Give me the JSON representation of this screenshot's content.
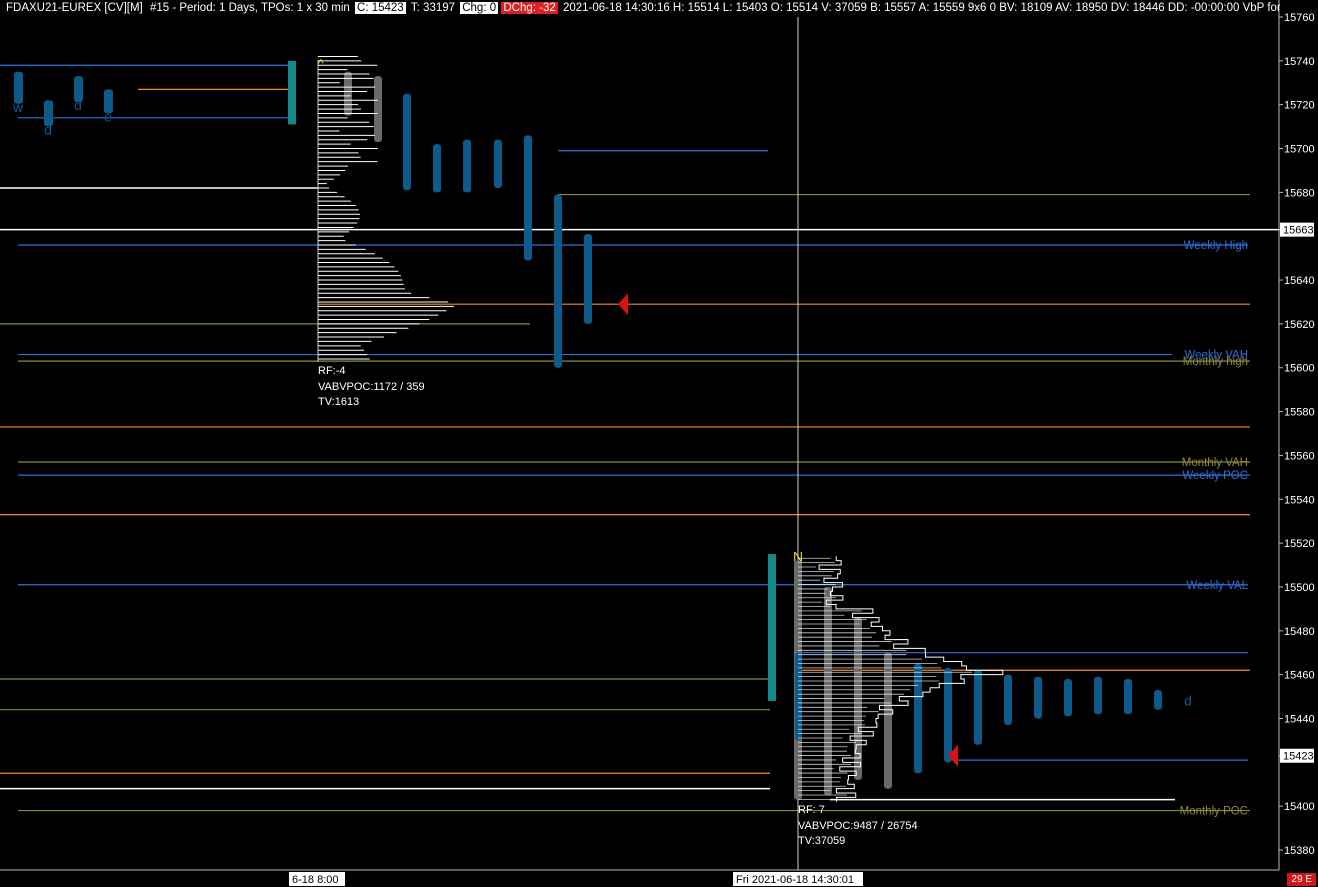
{
  "header": {
    "symbol": "FDAXU21-EUREX [CV][M]",
    "period": "#15 - Period: 1 Days, TPOs: 1 x 30 min",
    "close": "C: 15423",
    "trades": "T: 33197",
    "chg": "Chg: 0",
    "dchg": "DChg: -32",
    "rest": "2021-06-18 14:30:16 H: 15514 L: 15403 O: 15514 V: 37059 B: 15557 A: 15559 9x6 0 BV: 18109 AV: 18950 DV: 18446 DD: -00:00:00 VbP for TPO Chart"
  },
  "colors": {
    "background": "#000000",
    "blue": "#2f6fd6",
    "olive": "#8c8a3a",
    "orange": "#f08a30",
    "white": "#ffffff",
    "tpo_blue": "#0e5a8a",
    "tpo_gray": "#6a6a6a",
    "teal": "#138a8a",
    "red": "#e01010",
    "yellow": "#e8d820"
  },
  "chart_data": {
    "type": "tpo-profile",
    "y_axis": {
      "ylim": [
        15370,
        15770
      ],
      "ticks": [
        15760,
        15740,
        15720,
        15700,
        15680,
        15663,
        15640,
        15620,
        15600,
        15580,
        15560,
        15540,
        15520,
        15500,
        15480,
        15460,
        15440,
        15423,
        15400,
        15380
      ],
      "highlighted": [
        15663,
        15423
      ]
    },
    "x_axis": {
      "labels": [
        "6-18  8:00",
        "Fri 2021-06-18  14:30:01"
      ]
    },
    "level_labels": [
      {
        "text": "Weekly High",
        "price": 15656,
        "color": "blue"
      },
      {
        "text": "Monthly high",
        "price": 15603,
        "color": "olive"
      },
      {
        "text": "Weekly VAH",
        "price": 15606,
        "color": "blue"
      },
      {
        "text": "Monthly VAH",
        "price": 15557,
        "color": "olive"
      },
      {
        "text": "Weekly POC",
        "price": 15551,
        "color": "blue"
      },
      {
        "text": "Weekly VAL",
        "price": 15501,
        "color": "blue"
      },
      {
        "text": "Monthly POC",
        "price": 15398,
        "color": "olive"
      }
    ],
    "profiles": [
      {
        "session": "prior",
        "rf": "RF:-4",
        "vabvpoc": "VABVPOC:1172 / 359",
        "tv": "TV:1613",
        "high": 15742,
        "low": 15603,
        "poc": 15629,
        "vah": 15716,
        "val": 15605
      },
      {
        "session": "current",
        "rf": "RF: 7",
        "vabvpoc": "VABVPOC:9487 / 26754",
        "tv": "TV:37059",
        "high": 15514,
        "low": 15403,
        "poc": 15462,
        "vah": 15515,
        "val": 15448
      }
    ],
    "prior_tpo_letters": [
      "w",
      "d",
      "d",
      "e"
    ],
    "current_open_letter": "N",
    "current_last_letter": "d",
    "horizontal_levels": [
      {
        "price": 15738,
        "color": "blue"
      },
      {
        "price": 15727,
        "color": "orange"
      },
      {
        "price": 15714,
        "color": "blue"
      },
      {
        "price": 15682,
        "color": "white"
      },
      {
        "price": 15699,
        "color": "blue"
      },
      {
        "price": 15679,
        "color": "olive"
      },
      {
        "price": 15663,
        "color": "white"
      },
      {
        "price": 15656,
        "color": "blue"
      },
      {
        "price": 15629,
        "color": "orange"
      },
      {
        "price": 15620,
        "color": "olive"
      },
      {
        "price": 15606,
        "color": "blue"
      },
      {
        "price": 15603,
        "color": "olive"
      },
      {
        "price": 15573,
        "color": "orange"
      },
      {
        "price": 15557,
        "color": "olive"
      },
      {
        "price": 15551,
        "color": "blue"
      },
      {
        "price": 15533,
        "color": "orange"
      },
      {
        "price": 15501,
        "color": "blue"
      },
      {
        "price": 15470,
        "color": "blue"
      },
      {
        "price": 15462,
        "color": "orange"
      },
      {
        "price": 15458,
        "color": "olive"
      },
      {
        "price": 15444,
        "color": "olive"
      },
      {
        "price": 15421,
        "color": "blue"
      },
      {
        "price": 15415,
        "color": "orange"
      },
      {
        "price": 15408,
        "color": "white"
      },
      {
        "price": 15403,
        "color": "white"
      },
      {
        "price": 15398,
        "color": "olive"
      }
    ]
  },
  "footer": {
    "badge": "29 E"
  }
}
